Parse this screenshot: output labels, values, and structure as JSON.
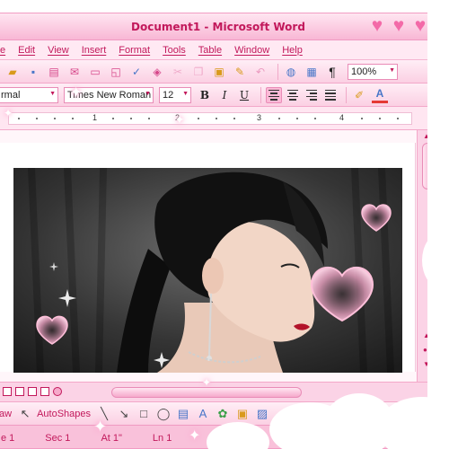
{
  "window": {
    "title": "Document1 - Microsoft Word"
  },
  "title_controls": [
    "heart-icon",
    "heart-icon",
    "heart-icon"
  ],
  "menu": {
    "items": [
      "e",
      "Edit",
      "View",
      "Insert",
      "Format",
      "Tools",
      "Table",
      "Window",
      "Help"
    ]
  },
  "toolbar": {
    "zoom": "100%"
  },
  "format": {
    "style": "rmal",
    "font": "Times New Roman",
    "size": "12",
    "bold": "B",
    "italic": "I",
    "underline": "U"
  },
  "ruler": {
    "numbers": [
      "1",
      "2",
      "3",
      "4"
    ]
  },
  "drawing": {
    "draw": "aw",
    "autoshapes": "AutoShapes"
  },
  "status": {
    "page": "e 1",
    "section": "Sec 1",
    "at": "At 1\"",
    "line": "Ln 1"
  },
  "colors": {
    "accent": "#c2185b",
    "chrome": "#fbd3e6",
    "heart": "#f36aa8"
  }
}
